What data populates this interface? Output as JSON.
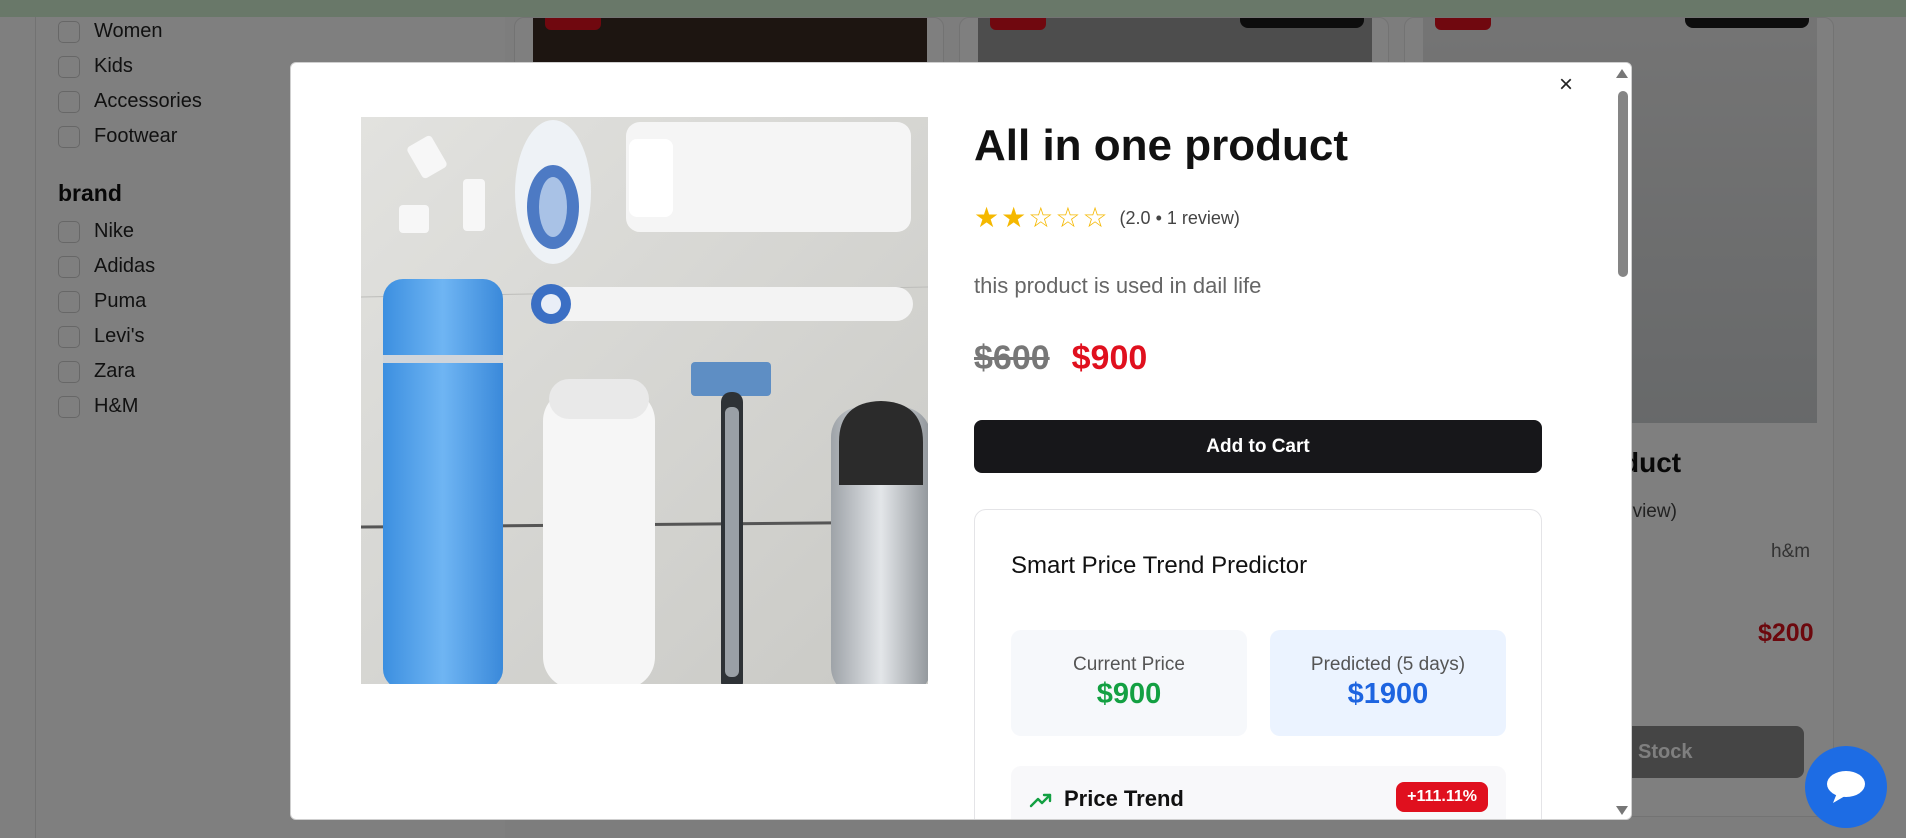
{
  "background": {
    "categories": [
      "Women",
      "Kids",
      "Accessories",
      "Footwear"
    ],
    "brand_heading": "brand",
    "brands": [
      "Nike",
      "Adidas",
      "Puma",
      "Levi's",
      "Zara",
      "H&M"
    ],
    "card": {
      "title_fragment": "duct",
      "review_fragment": "eview)",
      "brand": "h&m",
      "price": "$200",
      "button_fragment": "Stock"
    }
  },
  "modal": {
    "close_label": "×",
    "title": "All in one product",
    "rating": {
      "value": 2.0,
      "max": 5,
      "text": "(2.0 • 1 review)"
    },
    "description": "this product is used in dail life",
    "price": {
      "original": "$600",
      "current": "$900"
    },
    "add_to_cart_label": "Add to Cart",
    "predictor": {
      "title": "Smart Price Trend Predictor",
      "current_label": "Current Price",
      "current_value": "$900",
      "predicted_label": "Predicted (5 days)",
      "predicted_value": "$1900",
      "trend_label": "Price Trend",
      "trend_badge": "+111.11%"
    }
  },
  "icons": {
    "close": "close-icon",
    "trend": "trending-up-icon",
    "chat": "chat-bubble-icon",
    "star": "star-icon"
  },
  "colors": {
    "accent": "#e0101e",
    "dark_button": "#17171a",
    "green": "#13a042",
    "blue": "#1d64e0",
    "chat": "#1d6ce4"
  }
}
